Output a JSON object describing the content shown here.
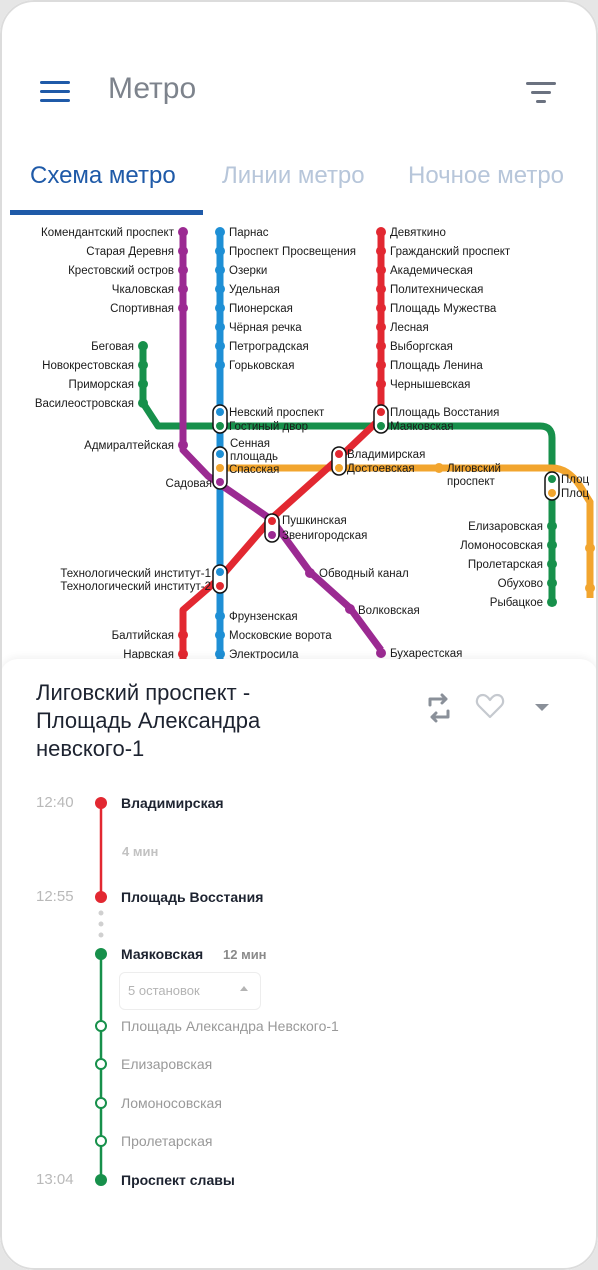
{
  "header": {
    "title": "Метро"
  },
  "tabs": [
    {
      "label": "Схема метро",
      "active": true
    },
    {
      "label": "Линии метро",
      "active": false
    },
    {
      "label": "Ночное метро",
      "active": false
    }
  ],
  "colors": {
    "accent": "#1f5aa8",
    "line_red": "#e22831",
    "line_blue": "#1e8fd5",
    "line_green": "#17904b",
    "line_orange": "#f2a52e",
    "line_purple": "#9b2a92"
  },
  "map": {
    "purple_line": [
      "Комендантский проспект",
      "Старая Деревня",
      "Крестовский остров",
      "Чкаловская",
      "Спортивная",
      "Адмиралтейская",
      "Садовая",
      "Звенигородская",
      "Обводный канал",
      "Волковская",
      "Бухарестская"
    ],
    "blue_line": [
      "Парнас",
      "Проспект Просвещения",
      "Озерки",
      "Удельная",
      "Пионерская",
      "Чёрная речка",
      "Петроградская",
      "Горьковская",
      "Невский проспект",
      "Сенная",
      "площадь",
      "Технологический институт-1",
      "Технологический институт-2",
      "Фрунзенская",
      "Московские ворота",
      "Электросила"
    ],
    "red_line": [
      "Девяткино",
      "Гражданский проспект",
      "Академическая",
      "Политехническая",
      "Площадь Мужества",
      "Лесная",
      "Выборгская",
      "Площадь Ленина",
      "Чернышевская",
      "Площадь Восстания",
      "Владимирская",
      "Пушкинская",
      "Балтийская",
      "Нарвская"
    ],
    "green_line": [
      "Беговая",
      "Новокрестовская",
      "Приморская",
      "Василеостровская",
      "Гостиный двор",
      "Маяковская",
      "Плоц",
      "Плоц",
      "Елизаровская",
      "Ломоносовская",
      "Пролетарская",
      "Обухово",
      "Рыбацкое"
    ],
    "orange_line": [
      "Спасская",
      "Достоевская",
      "Лиговский",
      "проспект"
    ]
  },
  "route": {
    "title_lines": [
      "Лиговский проспект -",
      "Площадь Александра",
      "невского-1"
    ],
    "steps": [
      {
        "time": "12:40",
        "station": "Владимирская"
      },
      {
        "duration": "4 мин"
      },
      {
        "time": "12:55",
        "station": "Площадь Восстания"
      },
      {
        "station": "Маяковская",
        "duration": "12 мин"
      },
      {
        "stops_label": "5 остановок"
      },
      {
        "station": "Площадь Александра Невского-1"
      },
      {
        "station": "Елизаровская"
      },
      {
        "station": "Ломоносовская"
      },
      {
        "station": "Пролетарская"
      },
      {
        "time": "13:04",
        "station": "Проспект славы"
      }
    ]
  }
}
